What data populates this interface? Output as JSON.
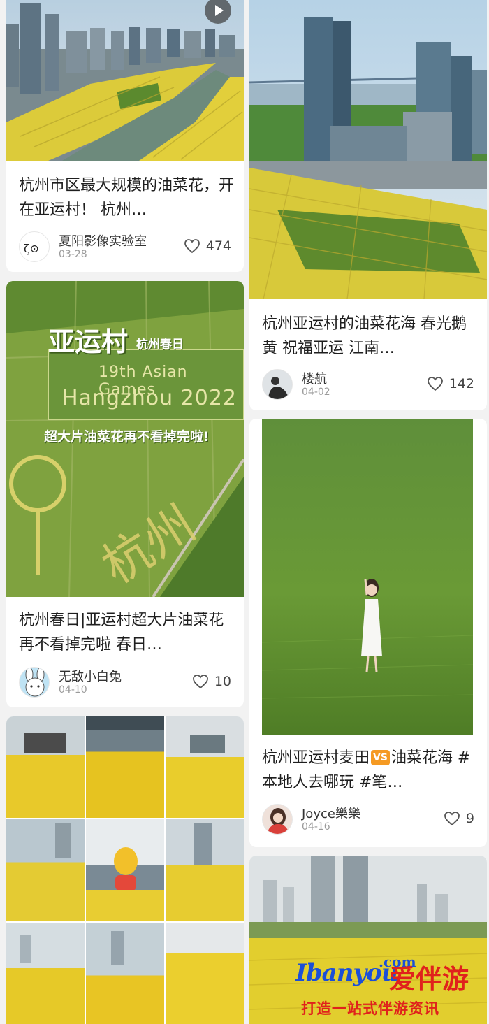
{
  "feed": [
    {
      "title": "杭州市区最大规模的油菜花，开在亚运村！ 杭州…",
      "author": "夏阳影像实验室",
      "date": "03-28",
      "likes": "474",
      "has_video": true
    },
    {
      "title": "杭州亚运村的油菜花海 春光鹅黄 祝福亚运 江南…",
      "author": "楼航",
      "date": "04-02",
      "likes": "142"
    },
    {
      "title": "杭州春日|亚运村超大片油菜花再不看掉完啦 春日…",
      "author": "无敌小白兔",
      "date": "04-10",
      "likes": "10",
      "overlay": {
        "headline": "亚运村",
        "headline_sub": "杭州春日",
        "games_line1": "19th Asian Games",
        "games_line2": "Hangzhou 2022",
        "banner": "超大片油菜花再不看掉完啦!",
        "field_text": "杭州"
      }
    },
    {
      "title_part1": "杭州亚运村麦田",
      "vs_badge": "VS",
      "title_part2": "油菜花海 #本地人去哪玩 #笔…",
      "author": "Joyce樂樂",
      "date": "04-16",
      "likes": "9"
    },
    {
      "collage_cells": 9
    },
    {
      "watermark": {
        "brand": "Ibanyou",
        "domain": ".com",
        "cn_name": "爱伴游",
        "slogan": "打造一站式伴游资讯"
      }
    }
  ],
  "icons": {
    "like": "heart-outline-icon",
    "video": "play-icon"
  },
  "colors": {
    "canape_yellow": "#e8d23a",
    "field_green": "#5f8f2c",
    "vs_orange": "#f59a23",
    "watermark_blue": "#1b4fd8",
    "watermark_red": "#e0221c"
  }
}
